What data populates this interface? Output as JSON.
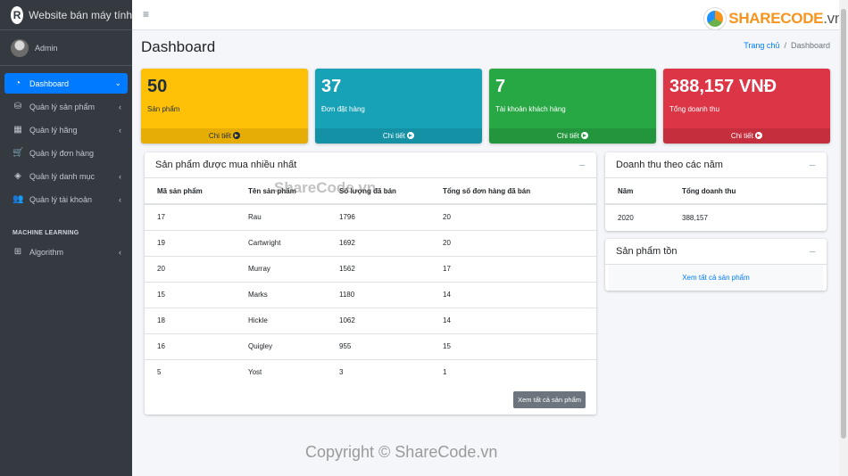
{
  "brand": {
    "logo": "R",
    "title": "Website bán máy tính"
  },
  "user": {
    "name": "Admin"
  },
  "sidebar": {
    "items": [
      {
        "label": "Dashboard",
        "icon": "dashboard-icon",
        "glyph": "◔"
      },
      {
        "label": "Quản lý sản phẩm",
        "icon": "boxes-icon",
        "glyph": "⛁"
      },
      {
        "label": "Quản lý hãng",
        "icon": "table-icon",
        "glyph": "▦"
      },
      {
        "label": "Quản lý đơn hàng",
        "icon": "cart-icon",
        "glyph": "🛒"
      },
      {
        "label": "Quản lý danh mục",
        "icon": "tags-icon",
        "glyph": "◈"
      },
      {
        "label": "Quản lý tài khoản",
        "icon": "users-icon",
        "glyph": "👥"
      }
    ],
    "section_header": "MACHINE LEARNING",
    "ml_items": [
      {
        "label": "Algorithm",
        "icon": "plus-square-icon",
        "glyph": "⊞"
      }
    ]
  },
  "topbar": {
    "menu_glyph": "≡",
    "logo_main": "SHARECODE",
    "logo_suffix": ".vn"
  },
  "header": {
    "title": "Dashboard",
    "breadcrumb": [
      "Trang chủ",
      "/",
      "Dashboard"
    ]
  },
  "stats": [
    {
      "value": "50",
      "label": "Sản phẩm",
      "footer": "Chi tiết",
      "color": "#ffc107"
    },
    {
      "value": "37",
      "label": "Đơn đặt hàng",
      "footer": "Chi tiết",
      "color": "#17a2b8"
    },
    {
      "value": "7",
      "label": "Tài khoản khách hàng",
      "footer": "Chi tiết",
      "color": "#28a745"
    },
    {
      "value": "388,157 VNĐ",
      "label": "Tổng doanh thu",
      "footer": "Chi tiết",
      "color": "#dc3545"
    }
  ],
  "top_products": {
    "title": "Sản phẩm được mua nhiều nhất",
    "collapse_glyph": "−",
    "columns": [
      "Mã sản phẩm",
      "Tên sản phẩm",
      "Số lượng đã bán",
      "Tổng số đơn hàng đã bán"
    ],
    "rows": [
      [
        "17",
        "Rau",
        "1796",
        "20"
      ],
      [
        "19",
        "Cartwright",
        "1692",
        "20"
      ],
      [
        "20",
        "Murray",
        "1562",
        "17"
      ],
      [
        "15",
        "Marks",
        "1180",
        "14"
      ],
      [
        "18",
        "Hickle",
        "1062",
        "14"
      ],
      [
        "16",
        "Quigley",
        "955",
        "15"
      ],
      [
        "5",
        "Yost",
        "3",
        "1"
      ]
    ],
    "button": "Xem tất cả sản phẩm"
  },
  "revenue": {
    "title": "Doanh thu theo các năm",
    "collapse_glyph": "−",
    "columns": [
      "Năm",
      "Tổng doanh thu"
    ],
    "rows": [
      [
        "2020",
        "388,157"
      ]
    ]
  },
  "stock": {
    "title": "Sản phẩm tồn",
    "collapse_glyph": "−",
    "link": "Xem tất cả sản phẩm"
  },
  "watermarks": {
    "center": "ShareCode.vn",
    "bottom": "Copyright © ShareCode.vn"
  }
}
